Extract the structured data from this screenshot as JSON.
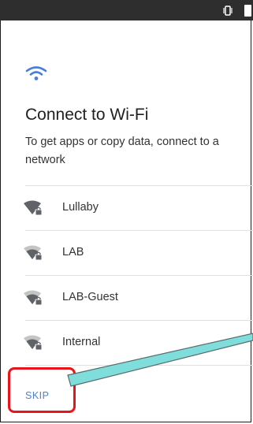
{
  "title": "Connect to Wi-Fi",
  "subtitle": "To get apps or copy data, connect to a network",
  "networks": [
    {
      "name": "Lullaby"
    },
    {
      "name": "LAB"
    },
    {
      "name": "LAB-Guest"
    },
    {
      "name": "Internal"
    }
  ],
  "skip_label": "SKIP",
  "colors": {
    "accent": "#4a7fd6",
    "status_bar": "#2e2e2e",
    "highlight": "#e8141b",
    "annotation_arrow": "#7fdedc"
  },
  "icons": {
    "status": [
      "vibrate-icon",
      "battery-icon"
    ],
    "header": "wifi-icon",
    "network": "wifi-lock-icon"
  }
}
